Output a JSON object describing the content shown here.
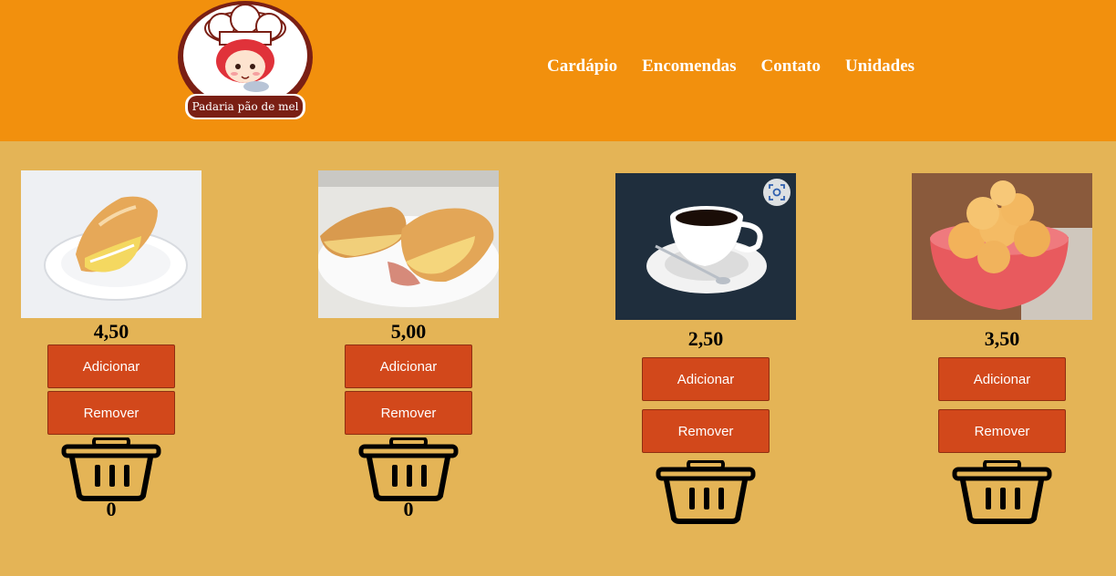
{
  "brand": {
    "name": "Padaria pão de mel"
  },
  "nav": [
    {
      "label": "Cardápio"
    },
    {
      "label": "Encomendas"
    },
    {
      "label": "Contato"
    },
    {
      "label": "Unidades"
    }
  ],
  "products": [
    {
      "image": "sandwich-on-plate-photo",
      "price": "4,50",
      "add_label": "Adicionar",
      "remove_label": "Remover",
      "icon": "trash-basket-icon",
      "quantity": "0"
    },
    {
      "image": "toasted-sandwiches-photo",
      "price": "5,00",
      "add_label": "Adicionar",
      "remove_label": "Remover",
      "icon": "trash-basket-icon",
      "quantity": "0"
    },
    {
      "image": "coffee-cup-photo",
      "price": "2,50",
      "add_label": "Adicionar",
      "remove_label": "Remover",
      "icon": "trash-basket-icon",
      "quantity": ""
    },
    {
      "image": "cheese-bread-bowl-photo",
      "price": "3,50",
      "add_label": "Adicionar",
      "remove_label": "Remover",
      "icon": "trash-basket-icon",
      "quantity": ""
    }
  ],
  "colors": {
    "header": "#f2900d",
    "background": "#e4b456",
    "button": "#d2481b",
    "nav_text": "#ffffff"
  }
}
